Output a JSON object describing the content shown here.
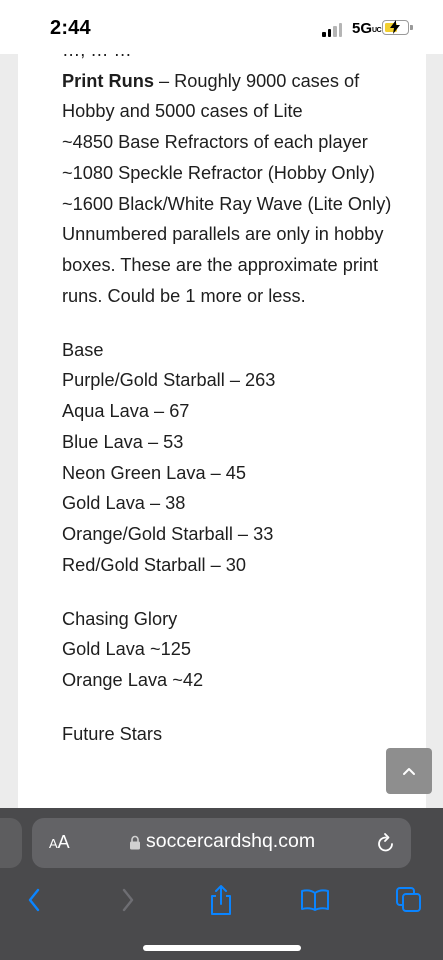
{
  "status_bar": {
    "time": "2:44",
    "network": "5G",
    "network_badge": "UC",
    "battery_color": "#f2cf2f"
  },
  "article": {
    "cut_line": "…, …  …",
    "print_runs_label": "Print Runs",
    "print_runs_text": " – Roughly 9000 cases of Hobby and 5000 cases of Lite",
    "lines": [
      "~4850 Base Refractors of each player",
      "~1080 Speckle Refractor (Hobby Only)",
      "~1600 Black/White Ray Wave (Lite Only)",
      "Unnumbered parallels are only in hobby boxes. These are the approximate print runs. Could be 1 more or less."
    ],
    "base_heading": "Base",
    "base_items": [
      "Purple/Gold Starball – 263",
      "Aqua Lava – 67",
      "Blue Lava – 53",
      "Neon Green Lava – 45",
      "Gold Lava – 38",
      "Orange/Gold Starball – 33",
      "Red/Gold Starball – 30"
    ],
    "chasing_heading": "Chasing Glory",
    "chasing_items": [
      "Gold Lava ~125",
      "Orange Lava ~42"
    ],
    "future_heading": "Future Stars"
  },
  "scroll_top": {
    "icon": "chevron-up-icon"
  },
  "browser": {
    "aa_small": "A",
    "aa_big": "A",
    "url": "soccercardshq.com",
    "lock_icon": "lock-icon",
    "reload_icon": "reload-icon",
    "nav_icons": [
      "back-icon",
      "forward-icon",
      "share-icon",
      "bookmarks-icon",
      "tabs-icon"
    ],
    "accent": "#0a84ff"
  }
}
